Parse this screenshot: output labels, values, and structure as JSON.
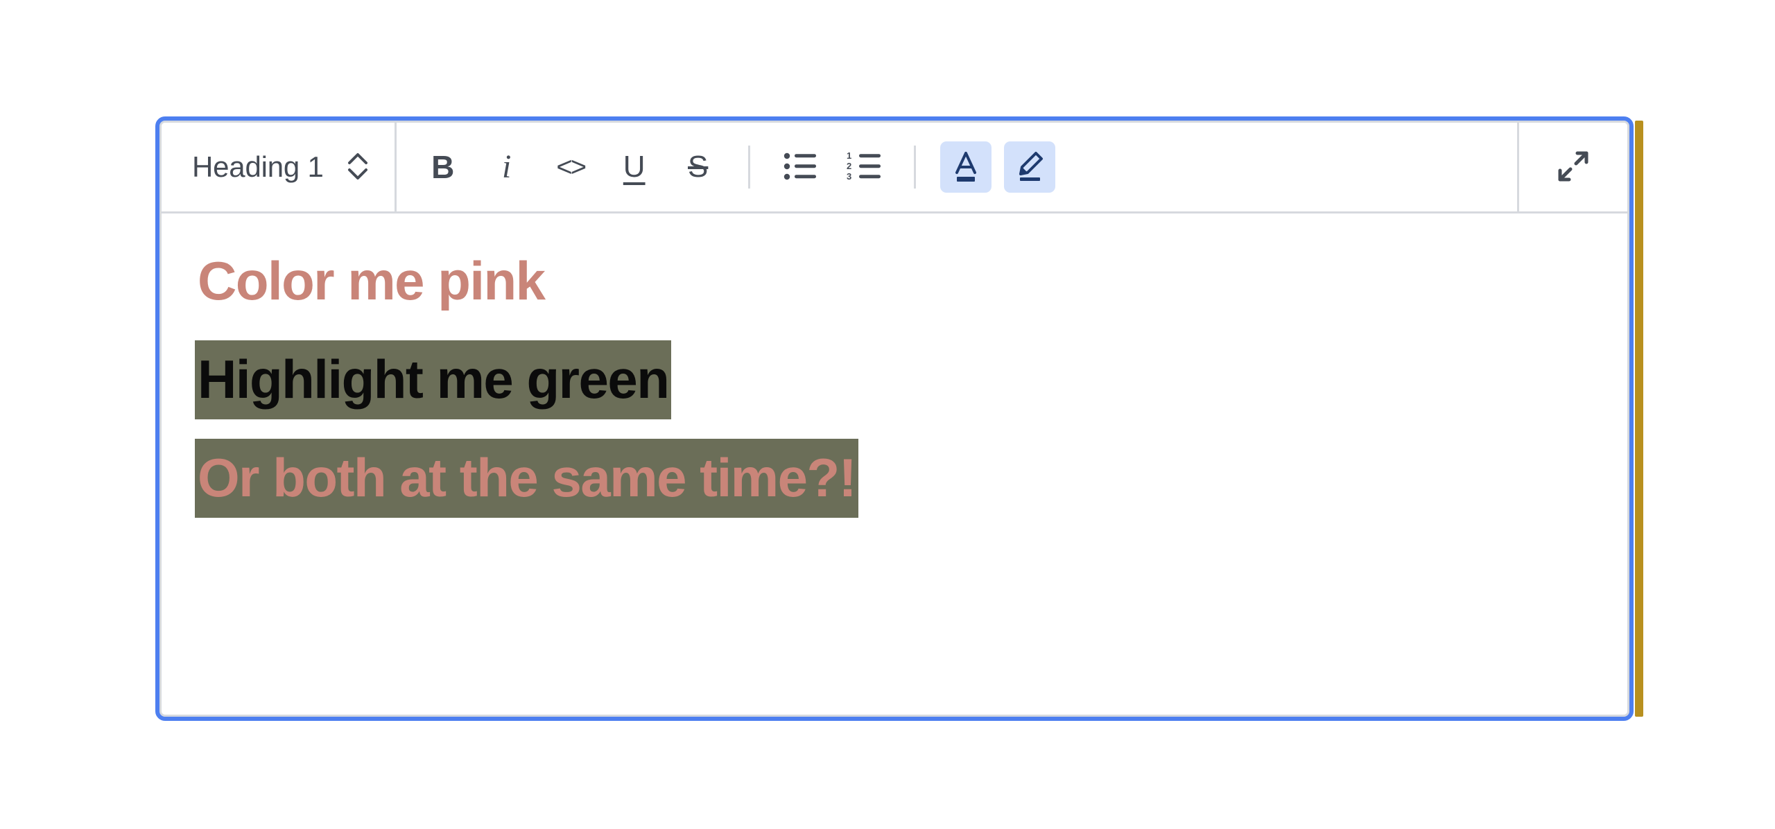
{
  "editor": {
    "name": "rich-text-editor",
    "focused": true,
    "colors": {
      "focus_ring": "#4d7ff0",
      "inner_border": "#d6d9de",
      "accent_strip": "#b8901f",
      "toolbar_icon": "#454b55",
      "active_button_bg": "#d3e1fb",
      "active_button_fg": "#1e3a6e",
      "text_pink": "#c98579",
      "highlight_green": "#6b6e58",
      "text_black": "#0b0b0b",
      "canvas": "#ffffff"
    }
  },
  "toolbar": {
    "block_type": {
      "label": "Heading 1",
      "icon": "chevron-up-down-icon"
    },
    "buttons": [
      {
        "id": "bold",
        "label": "B",
        "icon": "bold-icon",
        "active": false
      },
      {
        "id": "italic",
        "label": "i",
        "icon": "italic-icon",
        "active": false
      },
      {
        "id": "code",
        "label": "<>",
        "icon": "code-icon",
        "active": false
      },
      {
        "id": "underline",
        "label": "U",
        "icon": "underline-icon",
        "active": false
      },
      {
        "id": "strikethrough",
        "label": "S",
        "icon": "strikethrough-icon",
        "active": false
      }
    ],
    "list_buttons": [
      {
        "id": "bullet-list",
        "label": "",
        "icon": "bullet-list-icon",
        "active": false
      },
      {
        "id": "ordered-list",
        "label": "",
        "icon": "ordered-list-icon",
        "active": false
      }
    ],
    "color_buttons": [
      {
        "id": "text-color",
        "label": "",
        "icon": "text-color-a-icon",
        "active": true
      },
      {
        "id": "highlight",
        "label": "",
        "icon": "highlighter-pen-icon",
        "active": true
      }
    ],
    "ordered_list_numbers": [
      "1",
      "2",
      "3"
    ],
    "expand": {
      "label": "",
      "icon": "expand-diagonal-arrows-icon"
    }
  },
  "document": {
    "lines": [
      {
        "id": "line-1",
        "text": "Color me pink",
        "color": "#c98579",
        "highlight": null
      },
      {
        "id": "line-2",
        "text": "Highlight me green",
        "color": "#0b0b0b",
        "highlight": "#6b6e58"
      },
      {
        "id": "line-3",
        "text": "Or both at the same time?!",
        "color": "#c98579",
        "highlight": "#6b6e58"
      }
    ]
  }
}
